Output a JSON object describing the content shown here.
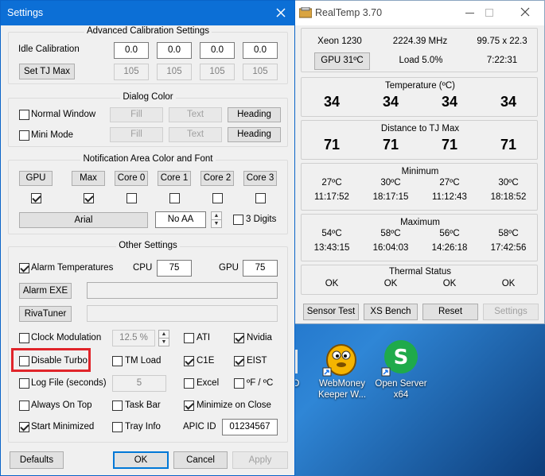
{
  "settings": {
    "title": "Settings",
    "calib": {
      "title": "Advanced Calibration Settings",
      "idle_label": "Idle Calibration",
      "idle_values": [
        "0.0",
        "0.0",
        "0.0",
        "0.0"
      ],
      "tjmax_button": "Set TJ Max",
      "tjmax_values": [
        "105",
        "105",
        "105",
        "105"
      ]
    },
    "dialog": {
      "title": "Dialog Color",
      "normal_window": "Normal Window",
      "mini_mode": "Mini Mode",
      "fill": "Fill",
      "text": "Text",
      "heading": "Heading"
    },
    "notif": {
      "title": "Notification Area Color and Font",
      "buttons": [
        "GPU",
        "Max",
        "Core 0",
        "Core 1",
        "Core 2",
        "Core 3"
      ],
      "checks": [
        true,
        true,
        false,
        false,
        false,
        false
      ],
      "font": "Arial",
      "aa": "No AA",
      "digits": "3 Digits"
    },
    "other": {
      "title": "Other Settings",
      "alarm_temps": "Alarm Temperatures",
      "cpu_label": "CPU",
      "cpu_value": "75",
      "gpu_label": "GPU",
      "gpu_value": "75",
      "alarm_exe": "Alarm EXE",
      "rivatuner": "RivaTuner",
      "clock_mod": "Clock Modulation",
      "clock_value": "12.5 %",
      "ati": "ATI",
      "nvidia": "Nvidia",
      "disable_turbo": "Disable Turbo",
      "tm_load": "TM Load",
      "c1e": "C1E",
      "eist": "EIST",
      "log_file": "Log File (seconds)",
      "log_value": "5",
      "excel": "Excel",
      "f_c": "ºF / ºC",
      "always_on_top": "Always On Top",
      "task_bar": "Task Bar",
      "minimize_on_close": "Minimize on Close",
      "start_minimized": "Start Minimized",
      "tray_info": "Tray Info",
      "apic_label": "APIC ID",
      "apic_value": "01234567"
    },
    "footer": {
      "defaults": "Defaults",
      "ok": "OK",
      "cancel": "Cancel",
      "apply": "Apply"
    }
  },
  "realtemp": {
    "title": "RealTemp 3.70",
    "cpu": "Xeon 1230",
    "freq": "2224.39 MHz",
    "mult": "99.75 x 22.3",
    "gpu_button": "GPU  31ºC",
    "load": "Load  5.0%",
    "time": "7:22:31",
    "temp_title": "Temperature (ºC)",
    "temps": [
      "34",
      "34",
      "34",
      "34"
    ],
    "dist_title": "Distance to TJ Max",
    "dists": [
      "71",
      "71",
      "71",
      "71"
    ],
    "min_title": "Minimum",
    "min_temps": [
      "27ºC",
      "30ºC",
      "27ºC",
      "30ºC"
    ],
    "min_times": [
      "11:17:52",
      "18:17:15",
      "11:12:43",
      "18:18:52"
    ],
    "max_title": "Maximum",
    "max_temps": [
      "54ºC",
      "58ºC",
      "56ºC",
      "58ºC"
    ],
    "max_times": [
      "13:43:15",
      "16:04:03",
      "14:26:18",
      "17:42:56"
    ],
    "thermal_title": "Thermal Status",
    "status": [
      "OK",
      "OK",
      "OK",
      "OK"
    ],
    "buttons": {
      "sensor_test": "Sensor Test",
      "xs_bench": "XS Bench",
      "reset": "Reset",
      "settings": "Settings"
    }
  },
  "desktop": {
    "webmoney": "WebMoney Keeper W...",
    "openserver": "Open Server x64",
    "partial": "O"
  }
}
